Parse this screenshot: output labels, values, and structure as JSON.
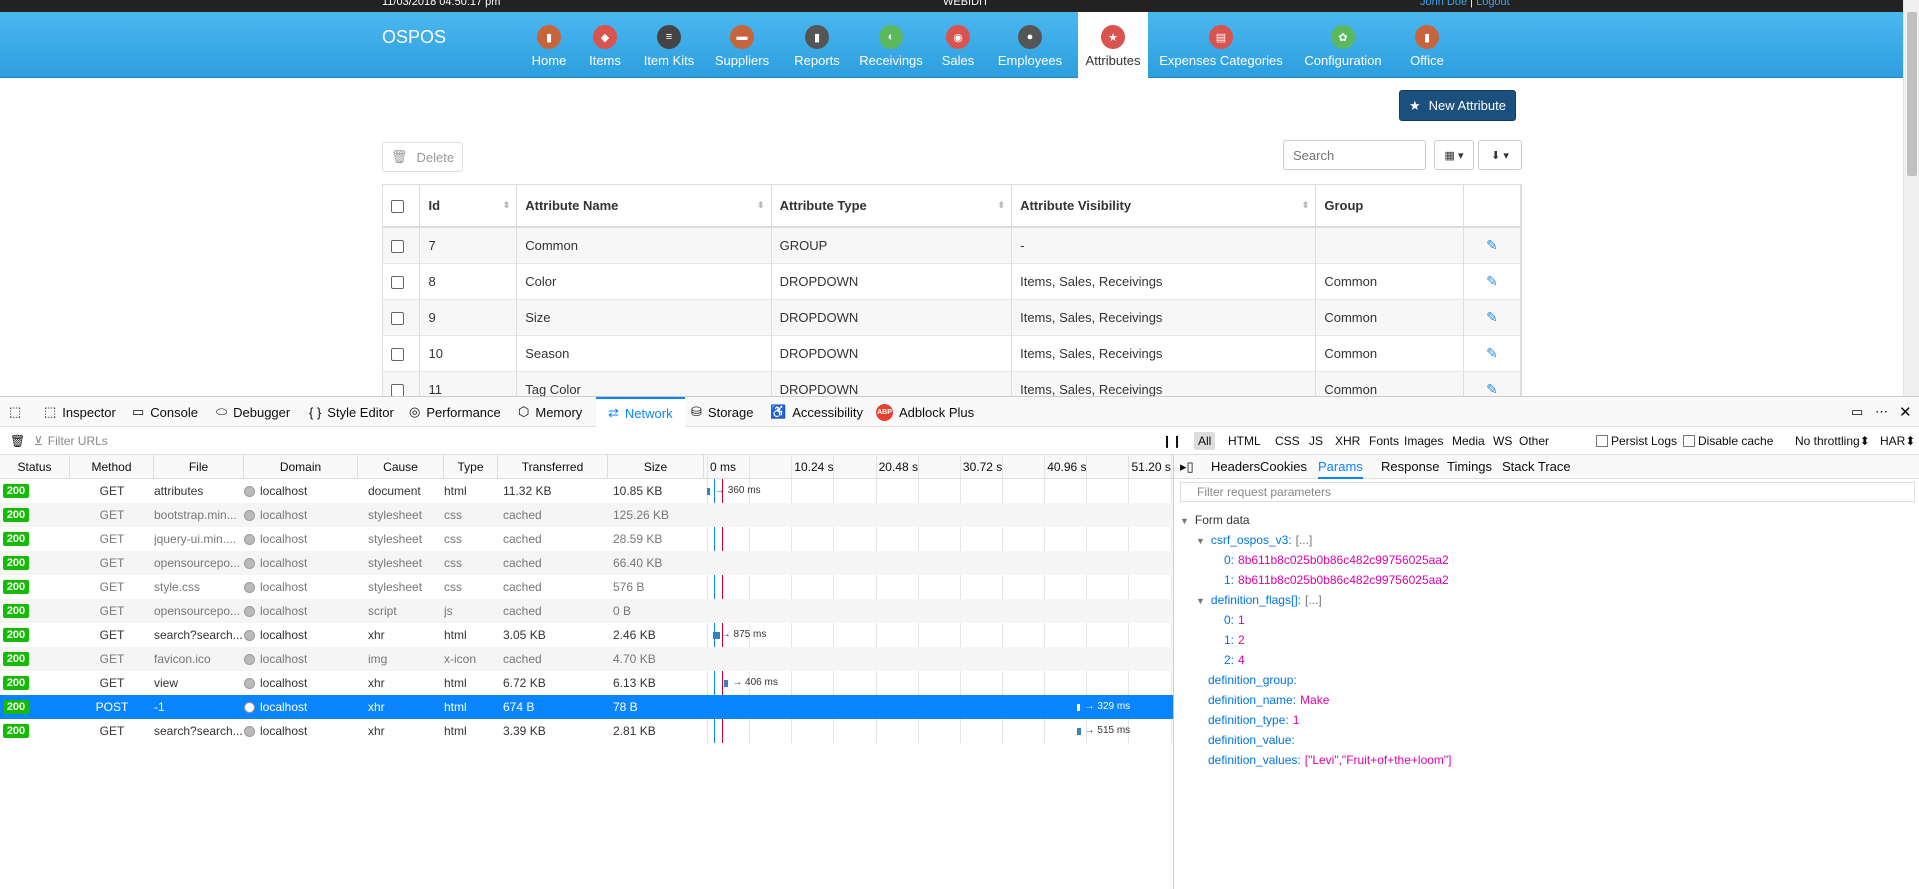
{
  "topbar": {
    "datetime": "11/03/2018 04:50:17 pm",
    "company": "WEBIDIT",
    "user": "John Doe",
    "separator": "|",
    "logout": "Logout"
  },
  "brand": "OSPOS",
  "nav": [
    {
      "label": "Home",
      "icon": "home-icon",
      "color": "#c8643b",
      "glyph": "▮"
    },
    {
      "label": "Items",
      "icon": "items-tag-icon",
      "color": "#d9534f",
      "glyph": "◆"
    },
    {
      "label": "Item Kits",
      "icon": "item-kits-stack-icon",
      "color": "#444",
      "glyph": "≡"
    },
    {
      "label": "Suppliers",
      "icon": "suppliers-briefcase-icon",
      "color": "#c8643b",
      "glyph": "▬"
    },
    {
      "label": "Reports",
      "icon": "reports-chart-icon",
      "color": "#555",
      "glyph": "▮"
    },
    {
      "label": "Receivings",
      "icon": "receivings-cart-icon",
      "color": "#5cb85c",
      "glyph": "◐"
    },
    {
      "label": "Sales",
      "icon": "sales-basket-icon",
      "color": "#d9534f",
      "glyph": "◉"
    },
    {
      "label": "Employees",
      "icon": "employees-person-icon",
      "color": "#555",
      "glyph": "●"
    },
    {
      "label": "Attributes",
      "icon": "attributes-star-icon",
      "color": "#d9534f",
      "glyph": "★"
    },
    {
      "label": "Expenses Categories",
      "icon": "expenses-categories-icon",
      "color": "#d9534f",
      "glyph": "▤"
    },
    {
      "label": "Configuration",
      "icon": "configuration-gear-icon",
      "color": "#5cb85c",
      "glyph": "✿"
    },
    {
      "label": "Office",
      "icon": "office-icon",
      "color": "#c8643b",
      "glyph": "▮"
    }
  ],
  "nav_active": "Attributes",
  "toolbar": {
    "new_attribute": "New Attribute",
    "delete": "Delete",
    "search_placeholder": "Search"
  },
  "table": {
    "headers": [
      "Id",
      "Attribute Name",
      "Attribute Type",
      "Attribute Visibility",
      "Group"
    ],
    "rows": [
      {
        "id": "7",
        "name": "Common",
        "type": "GROUP",
        "visibility": "-",
        "group": ""
      },
      {
        "id": "8",
        "name": "Color",
        "type": "DROPDOWN",
        "visibility": "Items, Sales, Receivings",
        "group": "Common"
      },
      {
        "id": "9",
        "name": "Size",
        "type": "DROPDOWN",
        "visibility": "Items, Sales, Receivings",
        "group": "Common"
      },
      {
        "id": "10",
        "name": "Season",
        "type": "DROPDOWN",
        "visibility": "Items, Sales, Receivings",
        "group": "Common"
      },
      {
        "id": "11",
        "name": "Tag Color",
        "type": "DROPDOWN",
        "visibility": "Items, Sales, Receivings",
        "group": "Common"
      }
    ]
  },
  "devtools": {
    "tabs": [
      "Inspector",
      "Console",
      "Debugger",
      "Style Editor",
      "Performance",
      "Memory",
      "Network",
      "Storage",
      "Accessibility",
      "Adblock Plus"
    ],
    "active_tab": "Network",
    "filter_placeholder": "Filter URLs",
    "type_filters": [
      "All",
      "HTML",
      "CSS",
      "JS",
      "XHR",
      "Fonts",
      "Images",
      "Media",
      "WS",
      "Other"
    ],
    "persist_logs": "Persist Logs",
    "disable_cache": "Disable cache",
    "throttling": "No throttling",
    "har": "HAR",
    "columns": [
      "Status",
      "Method",
      "File",
      "Domain",
      "Cause",
      "Type",
      "Transferred",
      "Size"
    ],
    "timeline_ticks": [
      "0 ms",
      "10.24 s",
      "20.48 s",
      "30.72 s",
      "40.96 s",
      "51.20 s"
    ],
    "requests": [
      {
        "status": "200",
        "method": "GET",
        "file": "attributes",
        "domain": "localhost",
        "cause": "document",
        "type": "html",
        "transferred": "11.32 KB",
        "size": "10.85 KB",
        "timing": "→ 360 ms",
        "start_s": 0,
        "cached": false
      },
      {
        "status": "200",
        "method": "GET",
        "file": "bootstrap.min...",
        "domain": "localhost",
        "cause": "stylesheet",
        "type": "css",
        "transferred": "cached",
        "size": "125.26 KB",
        "timing": "",
        "start_s": null,
        "cached": true
      },
      {
        "status": "200",
        "method": "GET",
        "file": "jquery-ui.min....",
        "domain": "localhost",
        "cause": "stylesheet",
        "type": "css",
        "transferred": "cached",
        "size": "28.59 KB",
        "timing": "",
        "start_s": null,
        "cached": true
      },
      {
        "status": "200",
        "method": "GET",
        "file": "opensourcepo...",
        "domain": "localhost",
        "cause": "stylesheet",
        "type": "css",
        "transferred": "cached",
        "size": "66.40 KB",
        "timing": "",
        "start_s": null,
        "cached": true
      },
      {
        "status": "200",
        "method": "GET",
        "file": "style.css",
        "domain": "localhost",
        "cause": "stylesheet",
        "type": "css",
        "transferred": "cached",
        "size": "576 B",
        "timing": "",
        "start_s": null,
        "cached": true
      },
      {
        "status": "200",
        "method": "GET",
        "file": "opensourcepo...",
        "domain": "localhost",
        "cause": "script",
        "type": "js",
        "transferred": "cached",
        "size": "0 B",
        "timing": "",
        "start_s": null,
        "cached": true
      },
      {
        "status": "200",
        "method": "GET",
        "file": "search?search...",
        "domain": "localhost",
        "cause": "xhr",
        "type": "html",
        "transferred": "3.05 KB",
        "size": "2.46 KB",
        "timing": "→ 875 ms",
        "start_s": 0.7,
        "cached": false
      },
      {
        "status": "200",
        "method": "GET",
        "file": "favicon.ico",
        "domain": "localhost",
        "cause": "img",
        "type": "x-icon",
        "transferred": "cached",
        "size": "4.70 KB",
        "timing": "",
        "start_s": null,
        "cached": true
      },
      {
        "status": "200",
        "method": "GET",
        "file": "view",
        "domain": "localhost",
        "cause": "xhr",
        "type": "html",
        "transferred": "6.72 KB",
        "size": "6.13 KB",
        "timing": "→ 406 ms",
        "start_s": 2.1,
        "cached": false
      },
      {
        "status": "200",
        "method": "POST",
        "file": "-1",
        "domain": "localhost",
        "cause": "xhr",
        "type": "html",
        "transferred": "674 B",
        "size": "78 B",
        "timing": "→ 329 ms",
        "start_s": 44.9,
        "cached": false,
        "selected": true
      },
      {
        "status": "200",
        "method": "GET",
        "file": "search?search...",
        "domain": "localhost",
        "cause": "xhr",
        "type": "html",
        "transferred": "3.39 KB",
        "size": "2.81 KB",
        "timing": "→ 515 ms",
        "start_s": 44.9,
        "cached": false
      }
    ],
    "side_tabs": [
      "Headers",
      "Cookies",
      "Params",
      "Response",
      "Timings",
      "Stack Trace"
    ],
    "side_active": "Params",
    "params_filter_placeholder": "Filter request parameters",
    "form_data_label": "Form data",
    "params": {
      "csrf_key": "csrf_ospos_v3:",
      "csrf_bracket": "[...]",
      "csrf_values": [
        {
          "k": "0:",
          "v": "8b611b8c025b0b86c482c99756025aa2"
        },
        {
          "k": "1:",
          "v": "8b611b8c025b0b86c482c99756025aa2"
        }
      ],
      "flags_key": "definition_flags[]:",
      "flags_bracket": "[...]",
      "flags_values": [
        {
          "k": "0:",
          "v": "1"
        },
        {
          "k": "1:",
          "v": "2"
        },
        {
          "k": "2:",
          "v": "4"
        }
      ],
      "group_key": "definition_group:",
      "name_key": "definition_name:",
      "name_val": "Make",
      "type_key": "definition_type:",
      "type_val": "1",
      "value_key": "definition_value:",
      "values_key": "definition_values:",
      "values_val": "[\"Levi\",\"Fruit+of+the+loom\"]"
    }
  }
}
